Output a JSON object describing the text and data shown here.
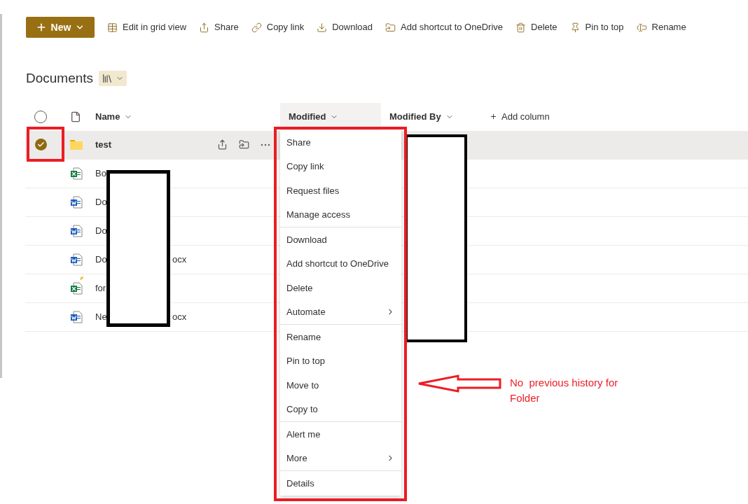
{
  "toolbar": {
    "new_button": {
      "label": "New"
    },
    "actions": [
      {
        "kind": "grid",
        "label": "Edit in grid view"
      },
      {
        "kind": "share",
        "label": "Share"
      },
      {
        "kind": "link",
        "label": "Copy link"
      },
      {
        "kind": "download",
        "label": "Download"
      },
      {
        "kind": "shortcut",
        "label": "Add shortcut to OneDrive"
      },
      {
        "kind": "delete",
        "label": "Delete"
      },
      {
        "kind": "pin",
        "label": "Pin to top"
      },
      {
        "kind": "rename",
        "label": "Rename"
      }
    ]
  },
  "library": {
    "title": "Documents"
  },
  "select_all": {
    "checked": false
  },
  "columns": [
    {
      "kind": "name",
      "label": "Name",
      "highlighted": false
    },
    {
      "kind": "date",
      "label": "Modified",
      "highlighted": true
    },
    {
      "kind": "person",
      "label": "Modified By",
      "highlighted": false
    },
    {
      "kind": "add",
      "label": "Add column",
      "highlighted": false
    }
  ],
  "rows": [
    {
      "kind": "folder",
      "name": "test",
      "selected": true,
      "new": false
    },
    {
      "kind": "excel",
      "name": "Bo",
      "selected": false,
      "new": false
    },
    {
      "kind": "word",
      "name": "Do",
      "selected": false,
      "new": false
    },
    {
      "kind": "word",
      "name": "Do",
      "selected": false,
      "new": false
    },
    {
      "kind": "word",
      "name": "Do",
      "name_end": "ocx",
      "selected": false,
      "new": false
    },
    {
      "kind": "excel",
      "name": "for",
      "selected": false,
      "new": true
    },
    {
      "kind": "word",
      "name": "Ne",
      "name_end": "ocx",
      "selected": false,
      "new": false
    }
  ],
  "context_menu": {
    "groups": [
      [
        {
          "label": "Share",
          "submenu": false
        },
        {
          "label": "Copy link",
          "submenu": false
        },
        {
          "label": "Request files",
          "submenu": false
        },
        {
          "label": "Manage access",
          "submenu": false
        }
      ],
      [
        {
          "label": "Download",
          "submenu": false
        },
        {
          "label": "Add shortcut to OneDrive",
          "submenu": false
        },
        {
          "label": "Delete",
          "submenu": false
        },
        {
          "label": "Automate",
          "submenu": true
        }
      ],
      [
        {
          "label": "Rename",
          "submenu": false
        },
        {
          "label": "Pin to top",
          "submenu": false
        },
        {
          "label": "Move to",
          "submenu": false
        },
        {
          "label": "Copy to",
          "submenu": false
        }
      ],
      [
        {
          "label": "Alert me",
          "submenu": false
        },
        {
          "label": "More",
          "submenu": true
        }
      ],
      [
        {
          "label": "Details",
          "submenu": false
        }
      ]
    ]
  },
  "annotation": {
    "text": "No  previous history for Folder"
  }
}
